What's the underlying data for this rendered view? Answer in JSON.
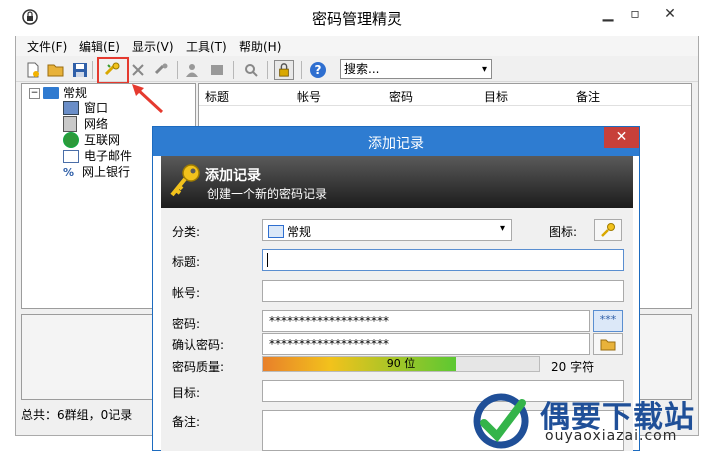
{
  "app": {
    "title": "密码管理精灵",
    "window_buttons": {
      "minimize": "▁",
      "restore": "▫",
      "close": "✕"
    }
  },
  "menu": [
    "文件(F)",
    "编辑(E)",
    "显示(V)",
    "工具(T)",
    "帮助(H)"
  ],
  "toolbar": {
    "icons": [
      "new-file-icon",
      "open-folder-icon",
      "save-icon",
      "add-record-icon",
      "cut-icon",
      "delete-icon",
      "user-icon",
      "group-icon",
      "search-icon",
      "lock-icon",
      "help-icon"
    ],
    "search_value": "搜索..."
  },
  "tree": {
    "root": "常规",
    "children": [
      "窗口",
      "网络",
      "互联网",
      "电子邮件",
      "网上银行"
    ]
  },
  "list": {
    "columns": [
      "标题",
      "帐号",
      "密码",
      "目标",
      "备注"
    ]
  },
  "status": "总共：6群组，0记录",
  "dialog": {
    "title": "添加记录",
    "close": "✕",
    "header_title": "添加记录",
    "header_subtitle": "创建一个新的密码记录",
    "labels": {
      "category": "分类:",
      "icon": "图标:",
      "title": "标题:",
      "account": "帐号:",
      "password": "密码:",
      "confirm": "确认密码:",
      "quality": "密码质量:",
      "target": "目标:",
      "note": "备注:"
    },
    "category_value": "常规",
    "title_value": "",
    "account_value": "",
    "password_value": "********************",
    "confirm_value": "********************",
    "show_button": "***",
    "quality_value": 0.7,
    "quality_text": "90 位",
    "quality_chars": "20 字符",
    "target_value": ""
  },
  "watermark": {
    "site_name": "偶要下载站",
    "url": "ouyaoxiazai.com"
  },
  "colors": {
    "dialog_title": "#2e7cd1",
    "close_red": "#c7403a",
    "highlight": "#e53a2f",
    "brand_blue": "#1f4f98"
  }
}
